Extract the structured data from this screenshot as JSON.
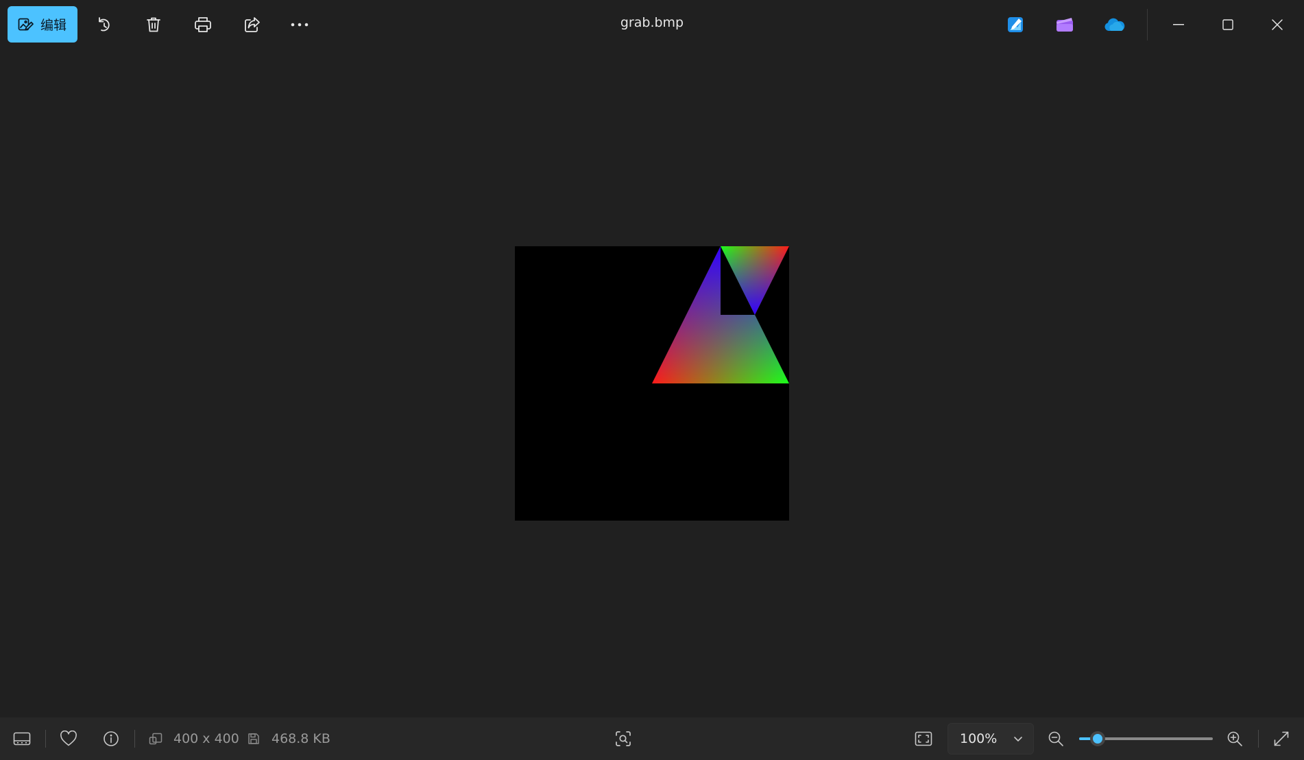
{
  "toolbar": {
    "edit_label": "编辑",
    "accent_color": "#4cc2ff"
  },
  "title": {
    "filename": "grab.bmp"
  },
  "status": {
    "dimensions": "400 x 400",
    "file_size": "468.8 KB",
    "zoom_value": "100%",
    "zoom_slider_fraction": 0.14
  },
  "icons": {
    "edit": "edit-image-icon",
    "rotate": "rotate-icon",
    "delete": "trash-icon",
    "print": "print-icon",
    "share": "share-icon",
    "more": "more-icon",
    "designer": "designer-app-icon",
    "clipchamp": "clipchamp-app-icon",
    "onedrive": "onedrive-cloud-icon",
    "minimize": "minimize-icon",
    "maximize": "maximize-icon",
    "close": "close-icon",
    "filmstrip": "filmstrip-icon",
    "favorite": "heart-icon",
    "info": "info-icon",
    "dimensions": "dimensions-icon",
    "file_size": "save-disk-icon",
    "visual_search": "visual-search-icon",
    "fit": "fit-to-window-icon",
    "zoom_out": "zoom-out-icon",
    "zoom_in": "zoom-in-icon",
    "fullscreen": "fullscreen-icon"
  },
  "image": {
    "background_color": "#000000",
    "colors": [
      "#ff1a1a",
      "#1aff1a",
      "#3300ff"
    ]
  }
}
